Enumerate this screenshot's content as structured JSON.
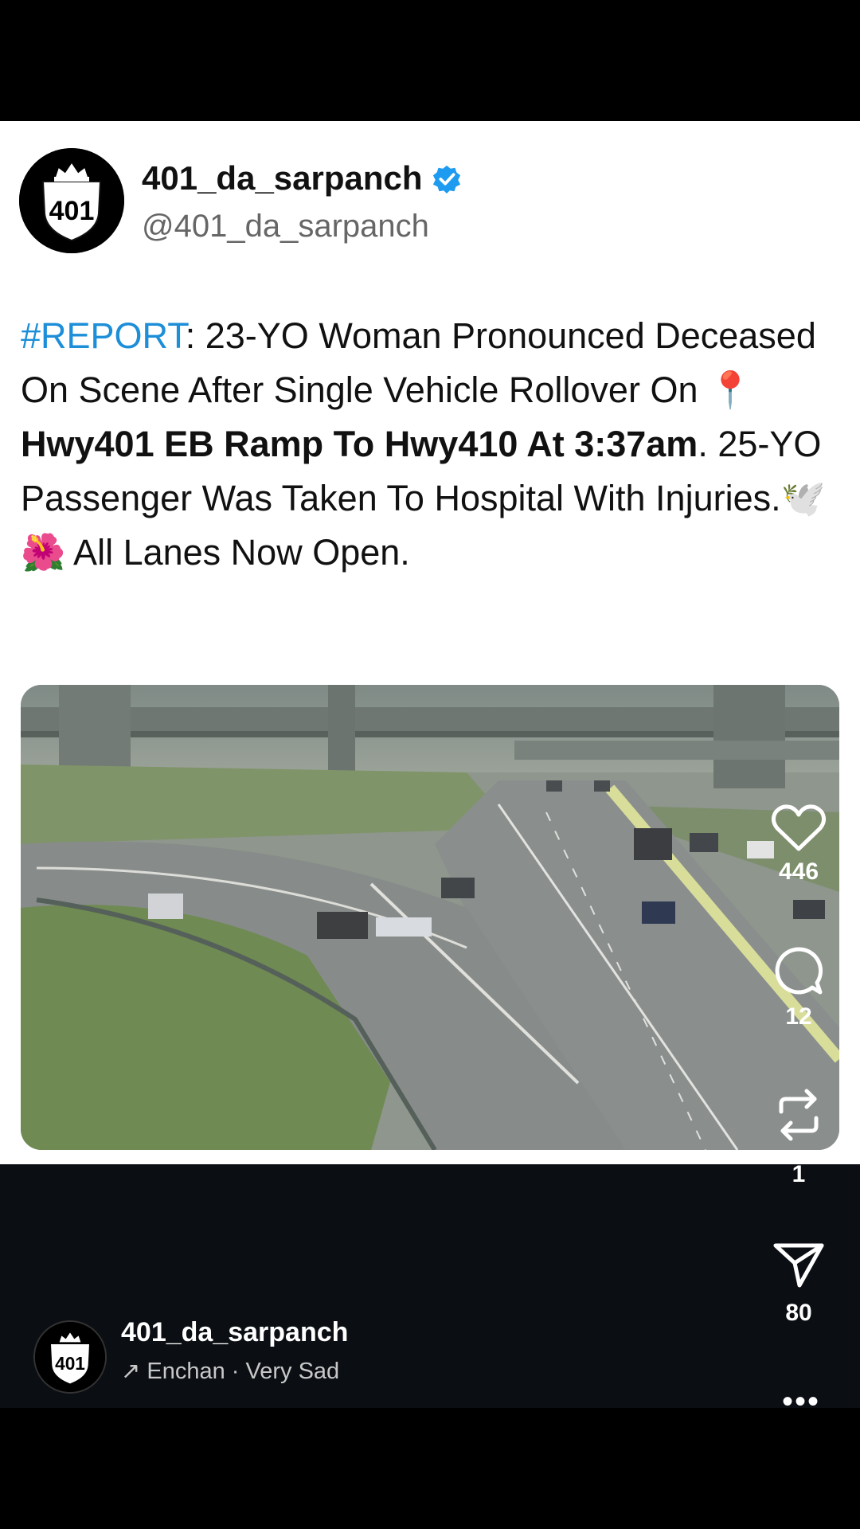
{
  "post": {
    "display_name": "401_da_sarpanch",
    "handle": "@401_da_sarpanch",
    "badge_number": "401",
    "text": {
      "hashtag": "#REPORT",
      "part1": ": 23-YO Woman Pronounced Deceased On Scene After Single Vehicle Rollover On ",
      "pin_emoji": "📍",
      "bold_location": "Hwy401 EB Ramp To Hwy410 At 3:37am",
      "part2": ". 25-YO Passenger Was Taken To Hospital With Injuries.",
      "emojis": "🕊️ 🌺",
      "part3": " All Lanes Now Open."
    }
  },
  "actions": {
    "likes": "446",
    "comments": "12",
    "reposts": "1",
    "shares": "80"
  },
  "footer": {
    "username": "401_da_sarpanch",
    "audio_arrow": "↗",
    "audio_text": "Enchan · Very Sad",
    "more": "•••"
  },
  "colors": {
    "hashtag": "#1d8ed8",
    "verified": "#1d9bf0",
    "dark_background": "#0b0f14"
  },
  "icons": [
    "heart-icon",
    "comment-icon",
    "repost-icon",
    "share-icon",
    "verified-icon",
    "more-icon"
  ]
}
